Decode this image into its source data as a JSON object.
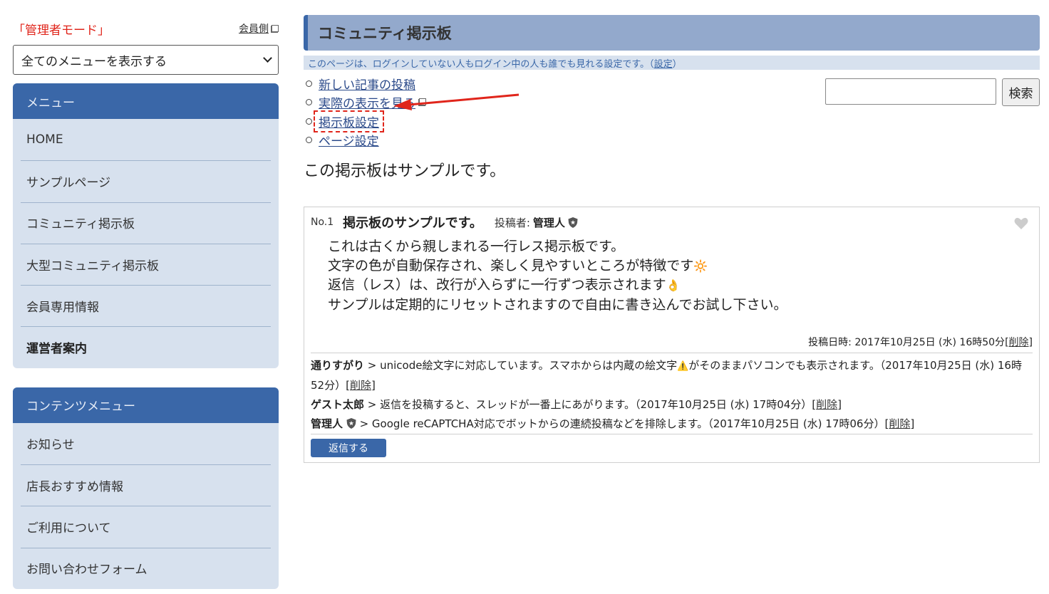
{
  "sidebar": {
    "admin_mode": "「管理者モード」",
    "member_side_link": "会員側",
    "menu_select_value": "全てのメニューを表示する",
    "menu": {
      "heading": "メニュー",
      "items": [
        {
          "label": "HOME"
        },
        {
          "label": "サンプルページ"
        },
        {
          "label": "コミュニティ掲示板"
        },
        {
          "label": "大型コミュニティ掲示板"
        },
        {
          "label": "会員専用情報"
        },
        {
          "label": "運営者案内"
        }
      ]
    },
    "content_menu": {
      "heading": "コンテンツメニュー",
      "items": [
        {
          "label": "お知らせ"
        },
        {
          "label": "店長おすすめ情報"
        },
        {
          "label": "ご利用について"
        },
        {
          "label": "お問い合わせフォーム"
        }
      ]
    }
  },
  "main": {
    "page_title": "コミュニティ掲示板",
    "notice_text": "このページは、ログインしていない人もログイン中の人も誰でも見れる設定です。（",
    "notice_link": "設定",
    "notice_close": "）",
    "tools": [
      {
        "label": "新しい記事の投稿"
      },
      {
        "label": "実際の表示を見る"
      },
      {
        "label": "掲示板設定"
      },
      {
        "label": "ページ設定"
      }
    ],
    "search": {
      "button_label": "検索",
      "value": ""
    },
    "board_description": "この掲示板はサンプルです。",
    "thread": {
      "number": "No.1",
      "title": "掲示板のサンプルです。",
      "author_label": "投稿者:",
      "author_name": "管理人",
      "body_lines": [
        "これは古くから親しまれる一行レス掲示板です。",
        "文字の色が自動保存され、楽しく見やすいところが特徴です",
        "返信（レス）は、改行が入らずに一行ずつ表示されます",
        "サンプルは定期的にリセットされますので自由に書き込んでお試し下さい。"
      ],
      "body_emojis": [
        "🔆",
        "👌"
      ],
      "posted_at": "投稿日時: 2017年10月25日 (水) 16時50分",
      "delete_label": "削除",
      "replies": [
        {
          "name": "通りすがり",
          "text_before": " > unicode絵文字に対応しています。スマホからは内蔵の絵文字",
          "emoji": "⚠️",
          "text_after": "がそのままパソコンでも表示されます。（2017年10月25日 (水) 16時52分）",
          "delete_label": "削除"
        },
        {
          "name": "ゲスト太郎",
          "text_before": " > 返信を投稿すると、スレッドが一番上にあがります。（2017年10月25日 (水) 17時04分）",
          "emoji": "",
          "text_after": "",
          "delete_label": "削除"
        },
        {
          "name": "管理人",
          "text_before": " > Google reCAPTCHA対応でボットからの連続投稿などを排除します。（2017年10月25日 (水) 17時06分）",
          "emoji": "",
          "text_after": "",
          "delete_label": "削除"
        }
      ],
      "reply_button": "返信する"
    }
  },
  "colors": {
    "accent": "#3a67a8",
    "sidebar_bg": "#d7e1ee",
    "title_bg": "#93a9cc",
    "admin_red": "#e0251b",
    "annotation_arrow": "#e0251b"
  },
  "icons": {
    "external_link": "external-link-icon",
    "shield": "shield-icon",
    "heart": "heart-icon",
    "dropdown": "chevron-down-icon"
  }
}
